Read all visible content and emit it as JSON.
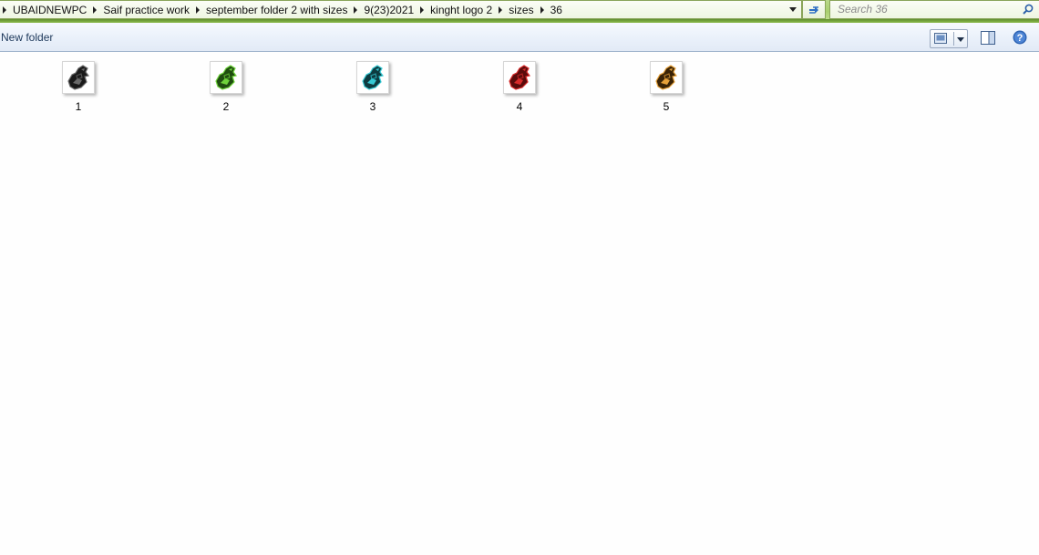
{
  "address_bar": {
    "crumbs": [
      "UBAIDNEWPC",
      "Saif practice work",
      "september folder 2 with sizes",
      "9(23)2021",
      "kinght logo 2",
      "sizes",
      "36"
    ]
  },
  "search": {
    "placeholder": "Search 36"
  },
  "toolbar": {
    "new_folder_label": "New folder"
  },
  "files": [
    {
      "name": "1",
      "color": "#1a1a1a",
      "accent": "#6a6a6a"
    },
    {
      "name": "2",
      "color": "#1f4d10",
      "accent": "#6fd33b"
    },
    {
      "name": "3",
      "color": "#0d3b40",
      "accent": "#35c9d4"
    },
    {
      "name": "4",
      "color": "#5a0b0b",
      "accent": "#d92a2a"
    },
    {
      "name": "5",
      "color": "#3a2306",
      "accent": "#e6a13a"
    }
  ],
  "icons": {
    "refresh": "refresh-icon",
    "search": "search-icon",
    "views": "change-view-icon",
    "preview_pane": "preview-pane-icon",
    "help": "help-icon"
  }
}
